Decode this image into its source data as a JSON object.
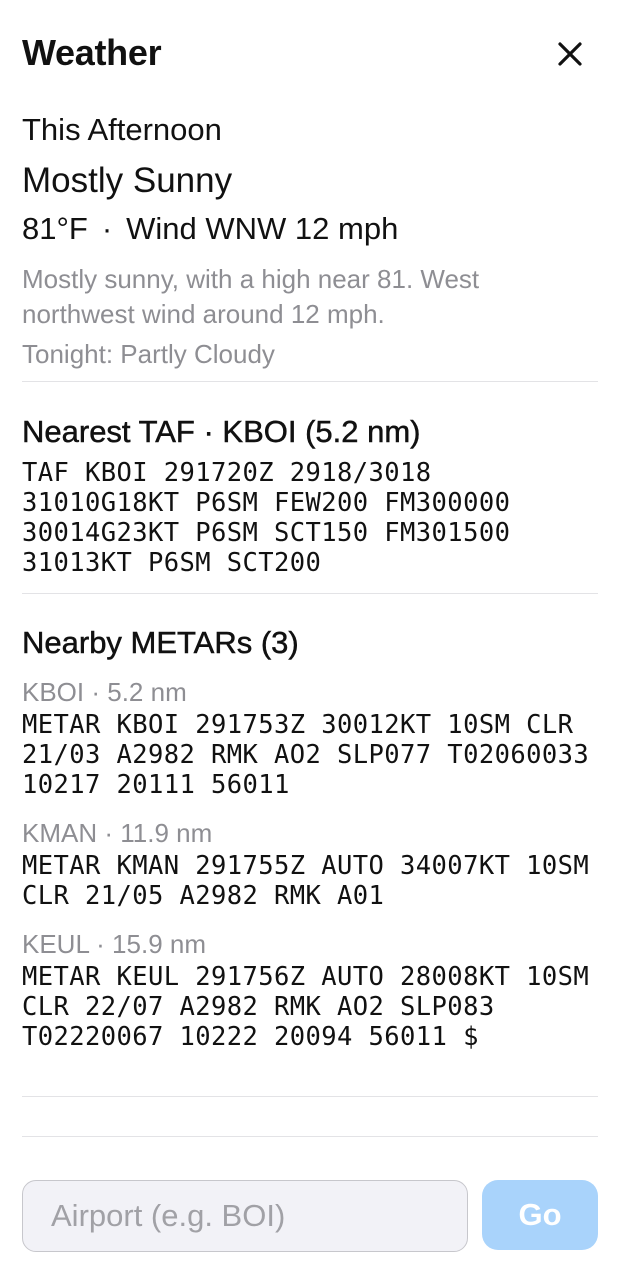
{
  "header": {
    "title": "Weather",
    "close_icon": "close-icon"
  },
  "forecast": {
    "period": "This Afternoon",
    "short": "Mostly Sunny",
    "temperature": "81°F",
    "separator": "·",
    "wind": "Wind WNW 12 mph",
    "detail": "Mostly sunny, with a high near 81. West northwest wind around 12 mph.",
    "tonight": "Tonight: Partly Cloudy"
  },
  "taf": {
    "title": "Nearest TAF · KBOI (5.2 nm)",
    "raw": "TAF KBOI 291720Z 2918/3018 31010G18KT P6SM FEW200 FM300000 30014G23KT P6SM SCT150 FM301500 31013KT P6SM SCT200"
  },
  "metars": {
    "title": "Nearby METARs (3)",
    "items": [
      {
        "label": "KBOI · 5.2 nm",
        "raw": "METAR KBOI 291753Z 30012KT 10SM CLR 21/03 A2982 RMK AO2 SLP077 T02060033 10217 20111 56011"
      },
      {
        "label": "KMAN · 11.9 nm",
        "raw": "METAR KMAN 291755Z AUTO 34007KT 10SM CLR 21/05 A2982 RMK A01"
      },
      {
        "label": "KEUL · 15.9 nm",
        "raw": "METAR KEUL 291756Z AUTO 28008KT 10SM CLR 22/07 A2982 RMK AO2 SLP083 T02220067 10222 20094 56011 $"
      }
    ]
  },
  "search": {
    "placeholder": "Airport (e.g. BOI)",
    "value": "",
    "go_label": "Go"
  },
  "colors": {
    "secondary_text": "#8e8e93",
    "go_button_disabled": "#a9d3fb",
    "divider": "#e3e3e6"
  }
}
